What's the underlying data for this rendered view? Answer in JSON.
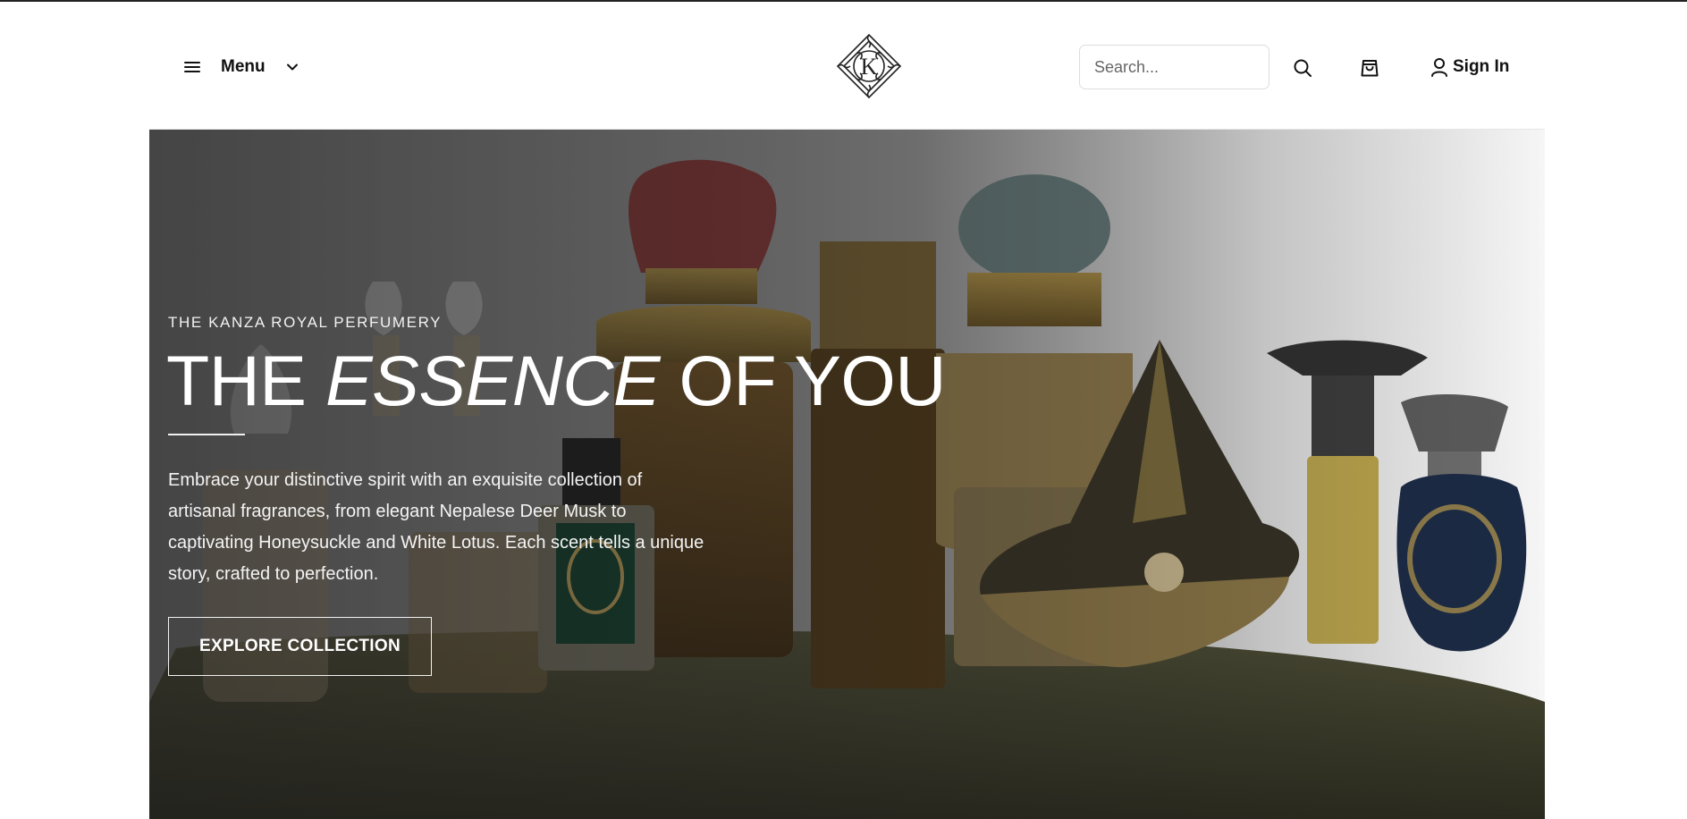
{
  "header": {
    "menu_label": "Menu",
    "brand_logo": "kanza-monogram-logo",
    "search_placeholder": "Search...",
    "search_value": "",
    "sign_in_label": "Sign In"
  },
  "hero": {
    "eyebrow": "THE KANZA ROYAL PERFUMERY",
    "headline_part1": "THE ",
    "headline_emphasis": "ESSENCE",
    "headline_part2": " OF YOU",
    "description": "Embrace your distinctive spirit with an exquisite collection of artisanal fragrances, from elegant Nepalese Deer Musk to captivating Honeysuckle and White Lotus. Each scent tells a unique story, crafted to perfection.",
    "cta_label": "EXPLORE COLLECTION"
  },
  "icons": {
    "menu": "hamburger-icon",
    "menu_chevron": "chevron-down-icon",
    "search": "search-icon",
    "cart": "shopping-bag-icon",
    "account": "user-icon"
  },
  "colors": {
    "text": "#111111",
    "hero_text": "#ffffff",
    "border": "#dddddd"
  }
}
